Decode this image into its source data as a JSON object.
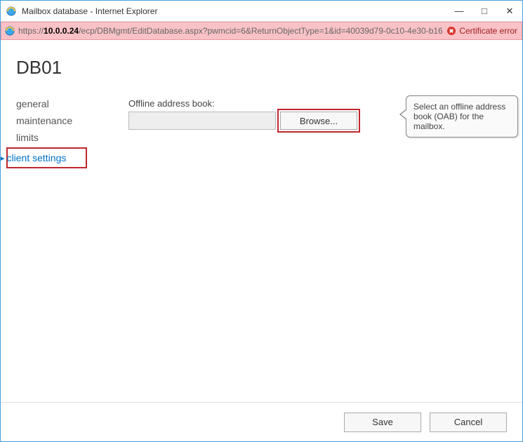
{
  "window": {
    "title": "Mailbox database - Internet Explorer"
  },
  "addressbar": {
    "prefix": "https://",
    "host": "10.0.0.24",
    "path": "/ecp/DBMgmt/EditDatabase.aspx?pwmcid=6&ReturnObjectType=1&id=40039d79-0c10-4e30-b16",
    "cert_error": "Certificate error"
  },
  "page": {
    "title": "DB01"
  },
  "sidebar": {
    "items": [
      {
        "label": "general"
      },
      {
        "label": "maintenance"
      },
      {
        "label": "limits"
      },
      {
        "label": "client settings"
      }
    ]
  },
  "main": {
    "oab_label": "Offline address book:",
    "oab_value": "",
    "browse_label": "Browse..."
  },
  "callout": {
    "text": "Select an offline address book (OAB) for the mailbox."
  },
  "footer": {
    "save": "Save",
    "cancel": "Cancel"
  }
}
